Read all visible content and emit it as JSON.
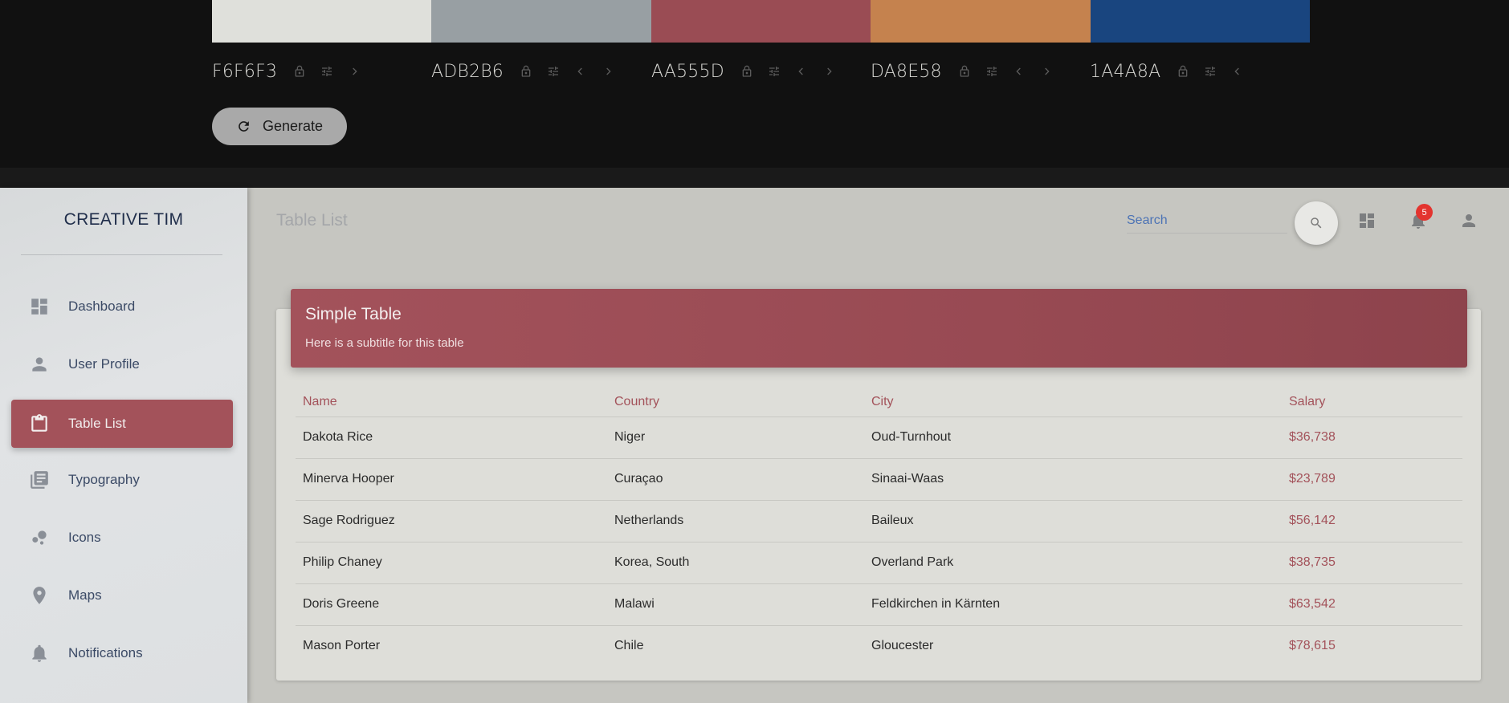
{
  "palette": {
    "swatches": [
      {
        "hex": "F6F6F3",
        "color": "#dfe0db",
        "has_prev": false,
        "has_next": true
      },
      {
        "hex": "ADB2B6",
        "color": "#989fa3",
        "has_prev": true,
        "has_next": true
      },
      {
        "hex": "AA555D",
        "color": "#9a4c54",
        "has_prev": true,
        "has_next": true
      },
      {
        "hex": "DA8E58",
        "color": "#c5824e",
        "has_prev": true,
        "has_next": true
      },
      {
        "hex": "1A4A8A",
        "color": "#19457f",
        "has_prev": true,
        "has_next": false
      }
    ],
    "generate_label": "Generate"
  },
  "sidebar": {
    "brand": "CREATIVE TIM",
    "items": [
      {
        "label": "Dashboard",
        "icon": "dashboard-icon",
        "active": false
      },
      {
        "label": "User Profile",
        "icon": "person-icon",
        "active": false
      },
      {
        "label": "Table List",
        "icon": "clipboard-icon",
        "active": true
      },
      {
        "label": "Typography",
        "icon": "library-books-icon",
        "active": false
      },
      {
        "label": "Icons",
        "icon": "bubble-chart-icon",
        "active": false
      },
      {
        "label": "Maps",
        "icon": "location-pin-icon",
        "active": false
      },
      {
        "label": "Notifications",
        "icon": "bell-icon",
        "active": false
      }
    ]
  },
  "topbar": {
    "title": "Table List",
    "search_placeholder": "Search",
    "notification_count": "5"
  },
  "table_card": {
    "title": "Simple Table",
    "subtitle": "Here is a subtitle for this table",
    "columns": [
      "Name",
      "Country",
      "City",
      "Salary"
    ],
    "rows": [
      [
        "Dakota Rice",
        "Niger",
        "Oud-Turnhout",
        "$36,738"
      ],
      [
        "Minerva Hooper",
        "Curaçao",
        "Sinaai-Waas",
        "$23,789"
      ],
      [
        "Sage Rodriguez",
        "Netherlands",
        "Baileux",
        "$56,142"
      ],
      [
        "Philip Chaney",
        "Korea, South",
        "Overland Park",
        "$38,735"
      ],
      [
        "Doris Greene",
        "Malawi",
        "Feldkirchen in Kärnten",
        "$63,542"
      ],
      [
        "Mason Porter",
        "Chile",
        "Gloucester",
        "$78,615"
      ]
    ]
  },
  "colors": {
    "accent": "#a3525a",
    "link": "#4c73b5",
    "badge": "#e3342f"
  }
}
